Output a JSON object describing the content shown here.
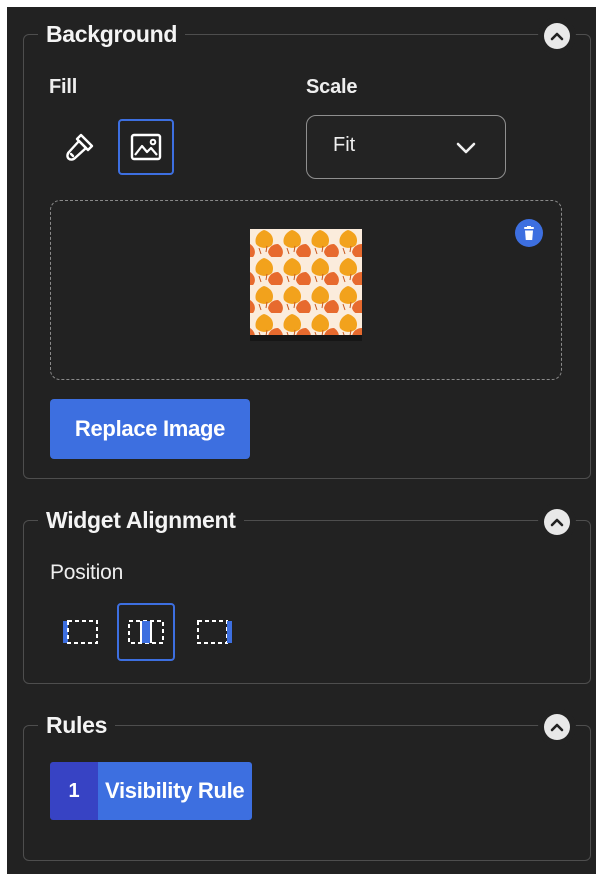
{
  "background_section": {
    "title": "Background",
    "fill_label": "Fill",
    "scale_label": "Scale",
    "scale_value": "Fit",
    "fill_options": [
      {
        "icon": "paint-brush-icon",
        "selected": false
      },
      {
        "icon": "image-icon",
        "selected": true
      }
    ],
    "replace_image_label": "Replace Image"
  },
  "alignment_section": {
    "title": "Widget Alignment",
    "position_label": "Position",
    "positions": [
      {
        "icon": "align-left-icon",
        "selected": false
      },
      {
        "icon": "align-center-icon",
        "selected": true
      },
      {
        "icon": "align-right-icon",
        "selected": false
      }
    ]
  },
  "rules_section": {
    "title": "Rules",
    "rule_number": "1",
    "rule_label": "Visibility Rule"
  },
  "colors": {
    "panel_bg": "#222222",
    "accent": "#3d6fe0",
    "accent_dark": "#3743c4",
    "border": "#4e4e4e"
  }
}
